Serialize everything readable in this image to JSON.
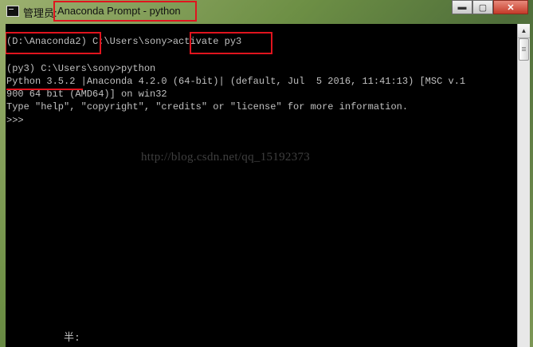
{
  "window": {
    "title_prefix": "管理员:",
    "title": "Anaconda Prompt - python",
    "controls": {
      "minimize": "▬",
      "maximize": "▢",
      "close": "✕"
    }
  },
  "console": {
    "lines": [
      "(D:\\Anaconda2) C:\\Users\\sony>activate py3",
      "",
      "(py3) C:\\Users\\sony>python",
      "Python 3.5.2 |Anaconda 4.2.0 (64-bit)| (default, Jul  5 2016, 11:41:13) [MSC v.1",
      "900 64 bit (AMD64)] on win32",
      "Type \"help\", \"copyright\", \"credits\" or \"license\" for more information.",
      ">>> "
    ]
  },
  "watermark": "http://blog.csdn.net/qq_15192373",
  "ime_indicator": "半:",
  "colors": {
    "console_bg": "#000000",
    "console_text": "#c0c0c0",
    "highlight": "#e0141e"
  }
}
